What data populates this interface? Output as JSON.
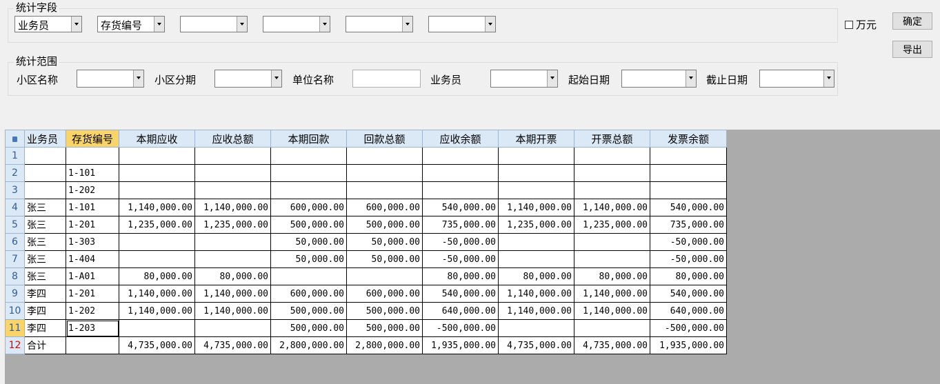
{
  "stat_fields": {
    "title": "统计字段",
    "combos": [
      "业务员",
      "存货编号",
      "",
      "",
      "",
      ""
    ]
  },
  "unit_checkbox": {
    "label": "万元",
    "checked": false
  },
  "buttons": {
    "confirm": "确定",
    "export": "导出"
  },
  "stat_range": {
    "title": "统计范围",
    "district_name_label": "小区名称",
    "district_phase_label": "小区分期",
    "unit_name_label": "单位名称",
    "salesperson_label": "业务员",
    "start_date_label": "起始日期",
    "end_date_label": "截止日期"
  },
  "grid": {
    "columns": [
      "业务员",
      "存货编号",
      "本期应收",
      "应收总额",
      "本期回款",
      "回款总额",
      "应收余额",
      "本期开票",
      "开票总额",
      "发票余额"
    ],
    "rows": [
      [
        "1",
        "",
        "",
        "",
        "",
        "",
        "",
        "",
        "",
        "",
        ""
      ],
      [
        "2",
        "",
        "1-101",
        "",
        "",
        "",
        "",
        "",
        "",
        "",
        ""
      ],
      [
        "3",
        "",
        "1-202",
        "",
        "",
        "",
        "",
        "",
        "",
        "",
        ""
      ],
      [
        "4",
        "张三",
        "1-101",
        "1,140,000.00",
        "1,140,000.00",
        "600,000.00",
        "600,000.00",
        "540,000.00",
        "1,140,000.00",
        "1,140,000.00",
        "540,000.00"
      ],
      [
        "5",
        "张三",
        "1-201",
        "1,235,000.00",
        "1,235,000.00",
        "500,000.00",
        "500,000.00",
        "735,000.00",
        "1,235,000.00",
        "1,235,000.00",
        "735,000.00"
      ],
      [
        "6",
        "张三",
        "1-303",
        "",
        "",
        "50,000.00",
        "50,000.00",
        "-50,000.00",
        "",
        "",
        "-50,000.00"
      ],
      [
        "7",
        "张三",
        "1-404",
        "",
        "",
        "50,000.00",
        "50,000.00",
        "-50,000.00",
        "",
        "",
        "-50,000.00"
      ],
      [
        "8",
        "张三",
        "1-A01",
        "80,000.00",
        "80,000.00",
        "",
        "",
        "80,000.00",
        "80,000.00",
        "80,000.00",
        "80,000.00"
      ],
      [
        "9",
        "李四",
        "1-201",
        "1,140,000.00",
        "1,140,000.00",
        "600,000.00",
        "600,000.00",
        "540,000.00",
        "1,140,000.00",
        "1,140,000.00",
        "540,000.00"
      ],
      [
        "10",
        "李四",
        "1-202",
        "1,140,000.00",
        "1,140,000.00",
        "500,000.00",
        "500,000.00",
        "640,000.00",
        "1,140,000.00",
        "1,140,000.00",
        "640,000.00"
      ],
      [
        "11",
        "李四",
        "1-203",
        "",
        "",
        "500,000.00",
        "500,000.00",
        "-500,000.00",
        "",
        "",
        "-500,000.00"
      ],
      [
        "12",
        "合计",
        "",
        "4,735,000.00",
        "4,735,000.00",
        "2,800,000.00",
        "2,800,000.00",
        "1,935,000.00",
        "4,735,000.00",
        "4,735,000.00",
        "1,935,000.00"
      ]
    ]
  }
}
